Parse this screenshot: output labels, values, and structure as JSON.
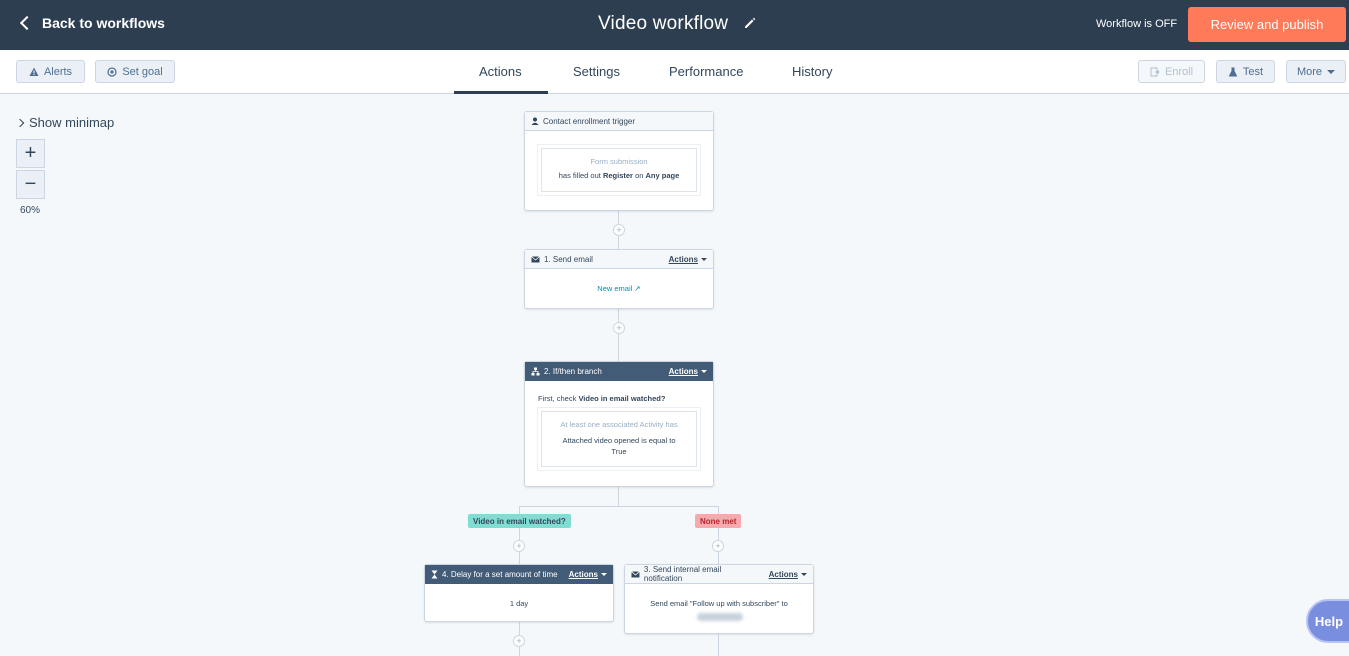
{
  "header": {
    "back_label": "Back to workflows",
    "title": "Video workflow",
    "status": "Workflow is OFF",
    "publish_label": "Review and publish"
  },
  "toolbar": {
    "alerts_label": "Alerts",
    "set_goal_label": "Set goal",
    "tabs": [
      {
        "label": "Actions",
        "active": true
      },
      {
        "label": "Settings",
        "active": false
      },
      {
        "label": "Performance",
        "active": false
      },
      {
        "label": "History",
        "active": false
      }
    ],
    "enroll_label": "Enroll",
    "test_label": "Test",
    "more_label": "More"
  },
  "canvas": {
    "minimap_label": "Show minimap",
    "zoom_in": "+",
    "zoom_out": "−",
    "zoom_level": "60%",
    "trigger": {
      "title": "Contact enrollment trigger",
      "filter_type": "Form submission",
      "filter_text_1": "has filled out",
      "filter_form": "Register",
      "filter_text_2": "on",
      "filter_page": "Any page"
    },
    "step1": {
      "title": "1. Send email",
      "actions_label": "Actions",
      "link": "New email"
    },
    "step2": {
      "title": "2. If/then branch",
      "actions_label": "Actions",
      "check_prefix": "First, check",
      "check_name": "Video in email watched?",
      "cond_line1": "At least one associated Activity has",
      "cond_line2": "Attached video opened is equal to",
      "cond_line3": "True"
    },
    "branch_yes": {
      "label": "Video in email watched?",
      "color": "#7fded1"
    },
    "branch_none": {
      "label": "None met",
      "color": "#f8a9ad"
    },
    "step4": {
      "title": "4. Delay for a set amount of time",
      "actions_label": "Actions",
      "body": "1 day"
    },
    "step3": {
      "title": "3. Send internal email notification",
      "actions_label": "Actions",
      "body": "Send email \"Follow up with subscriber\" to"
    },
    "plus": "+"
  },
  "help_label": "Help",
  "colors": {
    "topbar": "#2d3e50",
    "accent": "#ff7a59",
    "branch_header": "#425b76",
    "link": "#0091ae"
  }
}
